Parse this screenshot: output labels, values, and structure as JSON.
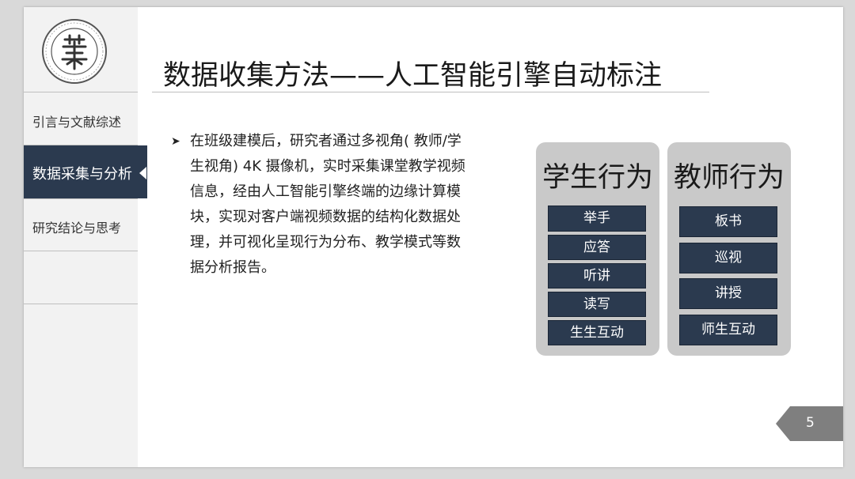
{
  "sidebar": {
    "items": [
      {
        "label": "引言与文献综述"
      },
      {
        "label": "数据采集与分析"
      },
      {
        "label": "研究结论与思考"
      }
    ]
  },
  "title": "数据收集方法——人工智能引擎自动标注",
  "bullet_lines": [
    "在班级建模后，研究者通过多视角( 教师/学",
    "生视角) 4K 摄像机，实时采集课堂教学视频",
    "信息，经由人工智能引擎终端的边缘计算模",
    "块，实现对客户端视频数据的结构化数据处",
    "理，并可视化呈现行为分布、教学模式等数",
    "据分析报告。"
  ],
  "panels": {
    "student": {
      "title": "学生行为",
      "items": [
        "举手",
        "应答",
        "听讲",
        "读写",
        "生生互动"
      ]
    },
    "teacher": {
      "title": "教师行为",
      "items": [
        "板书",
        "巡视",
        "讲授",
        "师生互动"
      ]
    }
  },
  "page_number": "5",
  "colors": {
    "nav_active": "#2b3a4f",
    "pill": "#2b3a4f",
    "panel": "#c9c9c9",
    "page_tab": "#7f7f7f"
  }
}
